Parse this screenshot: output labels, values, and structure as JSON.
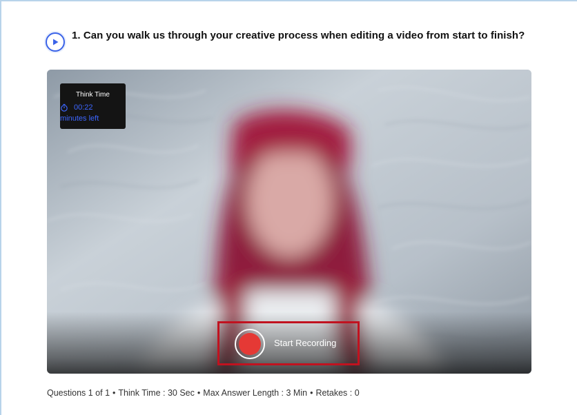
{
  "question": {
    "text": "1. Can you walk us through your creative process when editing a video from start to finish?"
  },
  "think_time_overlay": {
    "title": "Think Time",
    "timer": "00:22",
    "subtitle": "minutes left"
  },
  "recording": {
    "label": "Start Recording"
  },
  "meta": {
    "questions": "Questions 1 of 1",
    "think_time": "Think Time : 30 Sec",
    "max_answer_length": "Max Answer Length : 3 Min",
    "retakes": "Retakes : 0",
    "separator": "•"
  },
  "colors": {
    "accent": "#3b63e8",
    "timer_blue": "#3d66ff",
    "record_red": "#e53935",
    "highlight_red": "#c1121f"
  },
  "icons": {
    "play": "play-icon",
    "timer": "stopwatch-icon",
    "record": "record-icon"
  }
}
